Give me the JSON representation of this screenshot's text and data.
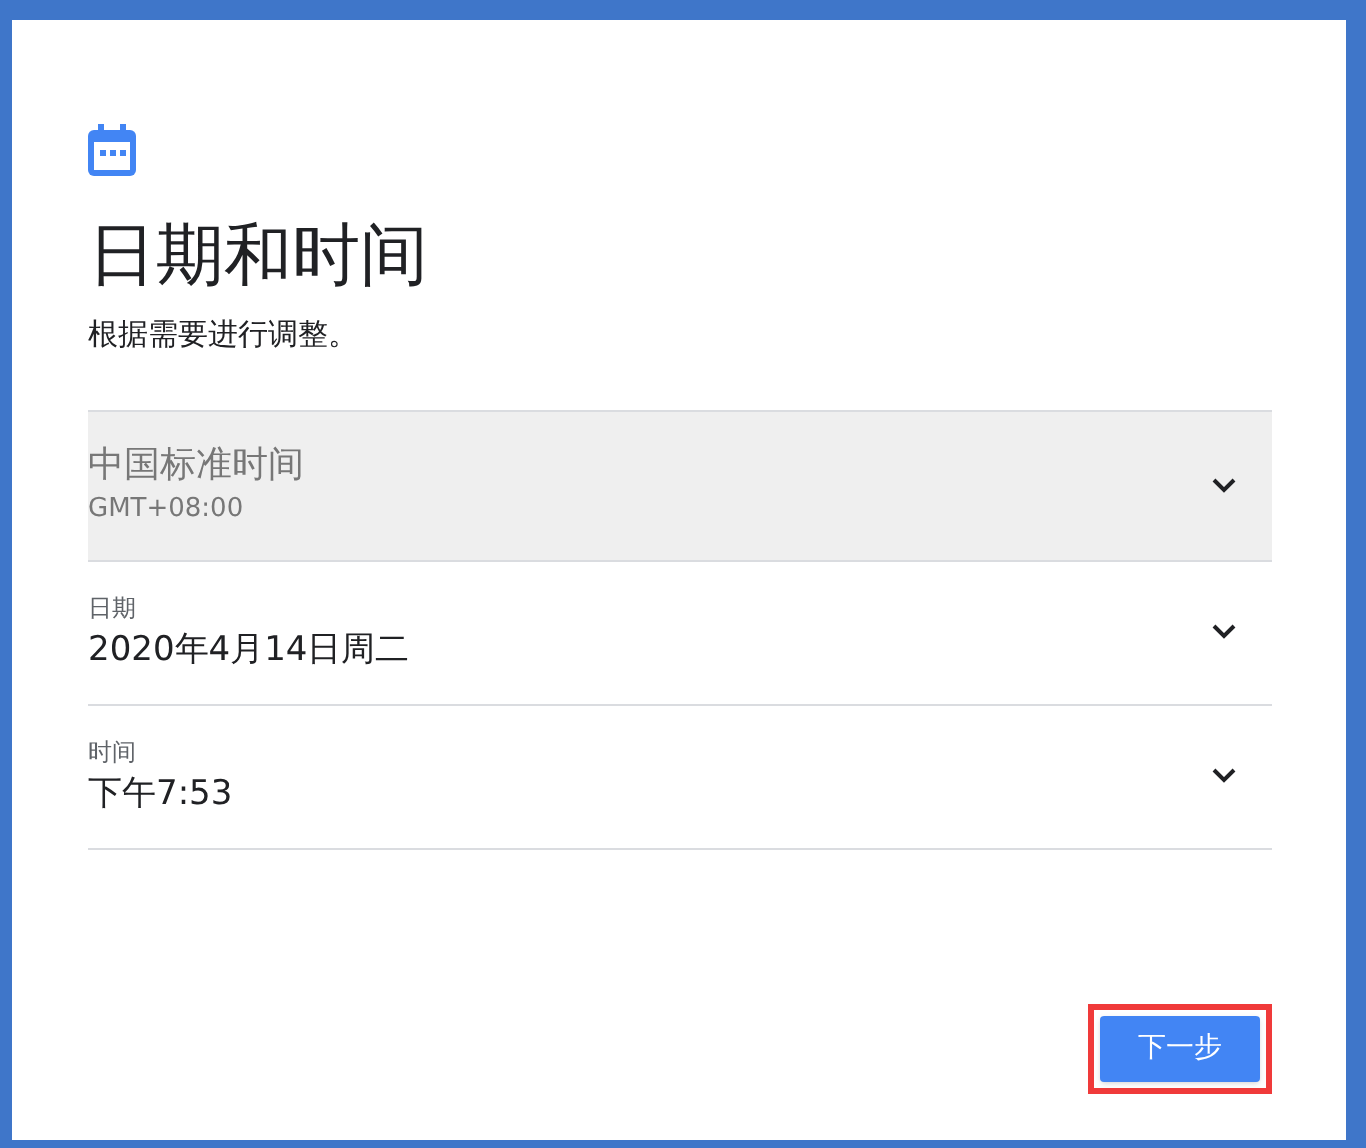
{
  "title": "日期和时间",
  "subtitle": "根据需要进行调整。",
  "settings": [
    {
      "kind": "timezone",
      "value": "中国标准时间",
      "detail": "GMT+08:00",
      "disabled": true
    },
    {
      "kind": "labeled",
      "label": "日期",
      "value": "2020年4月14日周二",
      "disabled": false
    },
    {
      "kind": "labeled",
      "label": "时间",
      "value": "下午7:53",
      "disabled": false
    }
  ],
  "next_button": {
    "label": "下一步",
    "highlighted": true
  }
}
